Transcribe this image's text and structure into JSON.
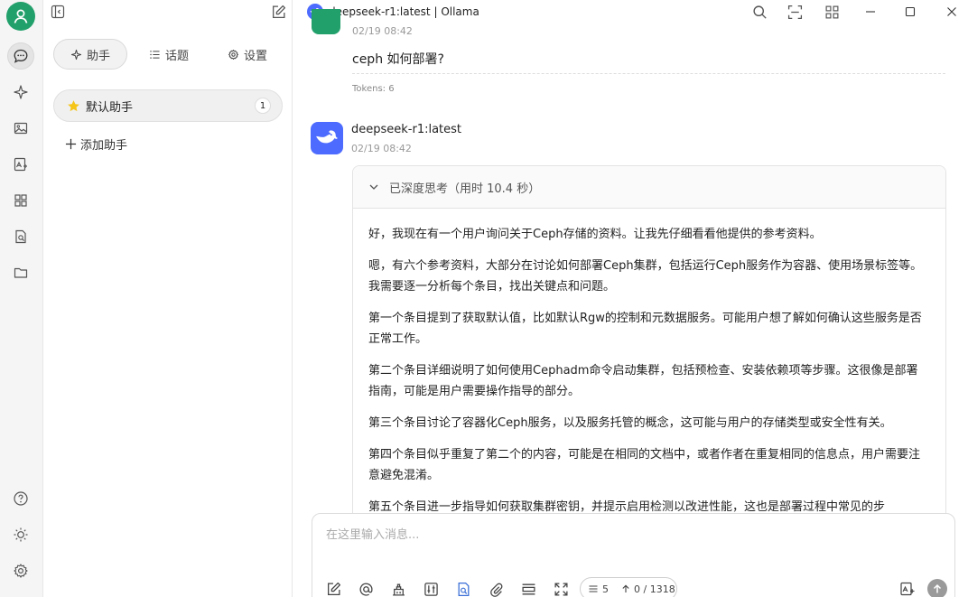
{
  "window": {
    "title": "deepseek-r1:latest | Ollama"
  },
  "sidebar": {
    "tabs": [
      {
        "label": "助手",
        "icon": "sparkle-icon"
      },
      {
        "label": "话题",
        "icon": "list-icon"
      },
      {
        "label": "设置",
        "icon": "gear-icon"
      }
    ],
    "assistant": {
      "name": "默认助手",
      "count": "1"
    },
    "add_assistant": "添加助手"
  },
  "chat": {
    "previous_time": "02/19 08:42",
    "user_message": "ceph 如何部署?",
    "tokens": "Tokens: 6",
    "bot_name": "deepseek-r1:latest",
    "bot_time": "02/19 08:42",
    "thinking_header": "已深度思考（用时 10.4 秒）",
    "thinking_paragraphs": [
      "好，我现在有一个用户询问关于Ceph存储的资料。让我先仔细看看他提供的参考资料。",
      "嗯，有六个参考资料，大部分在讨论如何部署Ceph集群，包括运行Ceph服务作为容器、使用场景标签等。我需要逐一分析每个条目，找出关键点和问题。",
      "第一个条目提到了获取默认值，比如默认Rgw的控制和元数据服务。可能用户想了解如何确认这些服务是否正常工作。",
      "第二个条目详细说明了如何使用Cephadm命令启动集群，包括预检查、安装依赖项等步骤。这很像是部署指南，可能是用户需要操作指导的部分。",
      "第三个条目讨论了容器化Ceph服务，以及服务托管的概念，这可能与用户的存储类型或安全性有关。",
      "第四个条目似乎重复了第二个的内容，可能是在相同的文档中，或者作者在重复相同的信息点，用户需要注意避免混淆。",
      "第五个条目进一步指导如何获取集群密钥，并提示启用检测以改进性能，这也是部署过程中常见的步"
    ]
  },
  "input": {
    "placeholder": "在这里输入消息...",
    "context_count": "5",
    "token_count": "0 / 1318"
  },
  "colors": {
    "brand_green": "#22a06b",
    "deepseek_blue": "#4d6bfe"
  }
}
